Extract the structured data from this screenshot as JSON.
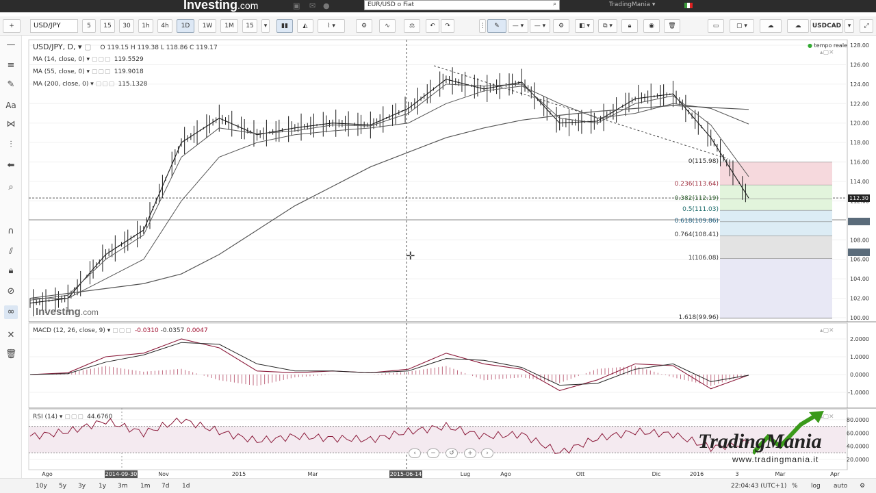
{
  "topbar": {
    "brand": "Investing",
    "brand_suffix": ".com",
    "search_placeholder": "EUR/USD o Fiat",
    "account_label": "TradingMania ▾"
  },
  "toolbar": {
    "symbol": "USD/JPY",
    "timeframes": [
      "5",
      "15",
      "30",
      "1h",
      "4h",
      "1D",
      "1W",
      "1M",
      "15"
    ],
    "active_timeframe": "1D",
    "compare_symbol": "USDCAD"
  },
  "legend": {
    "main_title": "USD/JPY, D,",
    "ohlc": "O 119.15  H 119.38  L 118.86  C 119.17",
    "ma14_label": "MA (14, close, 0)",
    "ma14_value": "119.5529",
    "ma55_label": "MA (55, close, 0)",
    "ma55_value": "119.9018",
    "ma200_label": "MA (200, close, 0)",
    "ma200_value": "115.1328",
    "realtime_label": "tempo reale",
    "macd_label": "MACD (12, 26, close, 9)",
    "macd_values": [
      "-0.0310",
      "-0.0357",
      "0.0047"
    ],
    "rsi_label": "RSI (14)",
    "rsi_value": "44.6760"
  },
  "fib_labels": [
    {
      "ratio": "0",
      "price": "115.98",
      "text": "0(115.98)"
    },
    {
      "ratio": "0.236",
      "price": "113.64",
      "text": "0.236(113.64)"
    },
    {
      "ratio": "0.382",
      "price": "112.19",
      "text": "0.382(112.19)"
    },
    {
      "ratio": "0.5",
      "price": "111.03",
      "text": "0.5(111.03)"
    },
    {
      "ratio": "0.618",
      "price": "109.86",
      "text": "0.618(109.86)"
    },
    {
      "ratio": "0.764",
      "price": "108.41",
      "text": "0.764(108.41)"
    },
    {
      "ratio": "1",
      "price": "106.08",
      "text": "1(106.08)"
    },
    {
      "ratio": "1.618",
      "price": "99.96",
      "text": "1.618(99.96)"
    }
  ],
  "price_tags": {
    "last": "112.30"
  },
  "x_axis": {
    "labels": [
      "Ago",
      "Nov",
      "2015",
      "Mar",
      "Lug",
      "Ago",
      "Ott",
      "Dic",
      "2016",
      "3",
      "Mar",
      "Apr"
    ],
    "highlight_left": "2014-09-30",
    "highlight_mid": "2015-06-14"
  },
  "bottombar": {
    "ranges": [
      "10y",
      "5y",
      "3y",
      "1y",
      "3m",
      "1m",
      "7d",
      "1d"
    ],
    "clock": "22:04:43 (UTC+1)",
    "percent": "%",
    "log": "log",
    "auto": "auto"
  },
  "watermark": {
    "investing": "Investing",
    "investing_suffix": ".com",
    "tm_brand": "TradingMania",
    "tm_url": "www.tradingmania.it"
  },
  "colors": {
    "price": "#1a1a1a",
    "ma": "#555555",
    "macd_line": "#8b1a3a",
    "signal_line": "#222222",
    "hist": "#c06a80",
    "rsi": "#8b1a3a",
    "fib_red": "#f6d9dd",
    "fib_green": "#e2f4dc",
    "fib_blue": "#dcecf5",
    "fib_gray": "#e3e3e3",
    "fib_lav": "#e8e8f5"
  },
  "chart_data": [
    {
      "type": "line",
      "title": "USD/JPY, D,",
      "ylim": [
        100,
        128
      ],
      "y_ticks": [
        "128.00",
        "126.00",
        "124.00",
        "122.00",
        "120.00",
        "118.00",
        "116.00",
        "114.00",
        "112.00",
        "110.00",
        "108.00",
        "106.00",
        "104.00",
        "102.00",
        "100.00"
      ],
      "x": [
        "2014-07",
        "2014-08",
        "2014-09",
        "2014-10",
        "2014-11",
        "2014-12",
        "2015-01",
        "2015-02",
        "2015-03",
        "2015-04",
        "2015-05",
        "2015-06",
        "2015-07",
        "2015-08",
        "2015-09",
        "2015-10",
        "2015-11",
        "2015-12",
        "2016-01",
        "2016-02"
      ],
      "series": [
        {
          "name": "USD/JPY",
          "values": [
            101.5,
            102.0,
            106.5,
            109.0,
            118.0,
            120.5,
            118.8,
            119.5,
            120.0,
            119.8,
            121.5,
            124.5,
            123.5,
            124.2,
            120.0,
            120.2,
            122.5,
            123.0,
            118.5,
            112.3
          ]
        },
        {
          "name": "MA (14, close, 0)",
          "values": [
            101.8,
            102.3,
            106.0,
            108.5,
            116.5,
            119.5,
            118.9,
            119.2,
            119.8,
            119.7,
            121.0,
            124.0,
            123.8,
            124.0,
            120.5,
            120.0,
            122.0,
            122.8,
            119.8,
            114.5
          ]
        },
        {
          "name": "MA (55, close, 0)",
          "values": [
            102.0,
            102.0,
            104.0,
            106.0,
            112.0,
            116.5,
            118.0,
            118.8,
            119.2,
            119.5,
            120.0,
            122.0,
            123.3,
            123.8,
            122.0,
            120.5,
            121.0,
            122.0,
            121.5,
            119.9
          ]
        },
        {
          "name": "MA (200, close, 0)",
          "values": [
            102.0,
            102.5,
            103.0,
            103.5,
            104.5,
            106.5,
            109.0,
            111.5,
            113.5,
            115.5,
            117.0,
            118.5,
            119.5,
            120.3,
            120.8,
            121.2,
            121.5,
            121.8,
            121.6,
            121.4
          ]
        }
      ]
    },
    {
      "type": "bar",
      "title": "MACD (12, 26, close, 9)",
      "ylim": [
        -1.5,
        2.5
      ],
      "y_ticks": [
        "2.0000",
        "1.0000",
        "0.0000",
        "-1.0000"
      ],
      "x": [
        "2014-07",
        "2014-08",
        "2014-09",
        "2014-10",
        "2014-11",
        "2014-12",
        "2015-01",
        "2015-02",
        "2015-03",
        "2015-04",
        "2015-05",
        "2015-06",
        "2015-07",
        "2015-08",
        "2015-09",
        "2015-10",
        "2015-11",
        "2015-12",
        "2016-01",
        "2016-02"
      ],
      "series": [
        {
          "name": "MACD",
          "values": [
            0.0,
            0.1,
            1.0,
            1.2,
            2.0,
            1.5,
            0.2,
            0.1,
            0.2,
            0.1,
            0.3,
            1.2,
            0.6,
            0.3,
            -0.9,
            -0.3,
            0.6,
            0.5,
            -0.8,
            -0.03
          ]
        },
        {
          "name": "Signal",
          "values": [
            0.0,
            0.05,
            0.7,
            1.1,
            1.8,
            1.7,
            0.6,
            0.2,
            0.2,
            0.1,
            0.2,
            0.9,
            0.8,
            0.4,
            -0.6,
            -0.5,
            0.3,
            0.6,
            -0.4,
            -0.04
          ]
        }
      ]
    },
    {
      "type": "line",
      "title": "RSI (14)",
      "ylim": [
        15,
        85
      ],
      "y_ticks": [
        "80.0000",
        "60.0000",
        "40.0000",
        "20.0000"
      ],
      "x": [
        "2014-07",
        "2014-08",
        "2014-09",
        "2014-10",
        "2014-11",
        "2014-12",
        "2015-01",
        "2015-02",
        "2015-03",
        "2015-04",
        "2015-05",
        "2015-06",
        "2015-07",
        "2015-08",
        "2015-09",
        "2015-10",
        "2015-11",
        "2015-12",
        "2016-01",
        "2016-02"
      ],
      "series": [
        {
          "name": "RSI (14)",
          "values": [
            55,
            62,
            78,
            60,
            80,
            62,
            48,
            55,
            52,
            50,
            62,
            70,
            55,
            58,
            30,
            52,
            62,
            58,
            38,
            44.676
          ]
        }
      ]
    }
  ]
}
